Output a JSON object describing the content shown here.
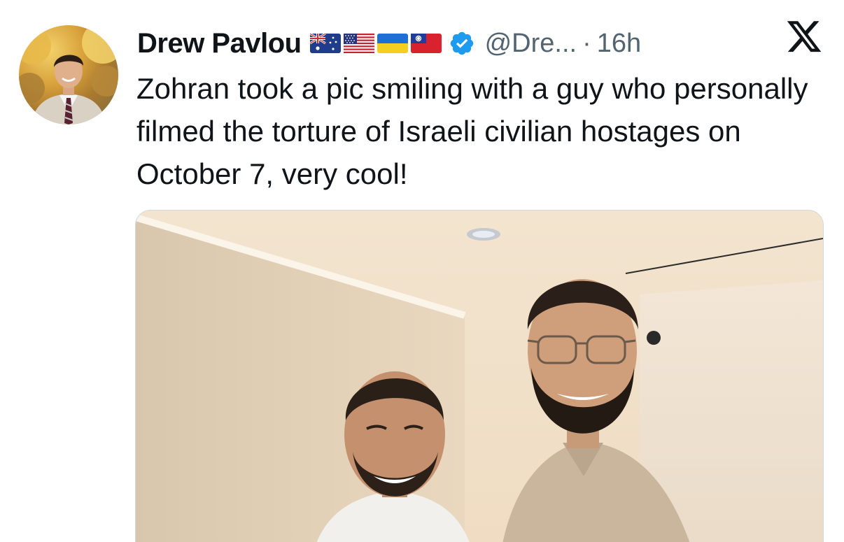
{
  "author": {
    "display_name": "Drew Pavlou",
    "handle": "@Dre...",
    "separator": "·",
    "time": "16h",
    "verified_icon": "verified-badge-icon",
    "flags": [
      {
        "name": "australia-flag-icon"
      },
      {
        "name": "united-states-flag-icon"
      },
      {
        "name": "ukraine-flag-icon"
      },
      {
        "name": "taiwan-flag-icon"
      }
    ]
  },
  "platform_icon": "x-logo-icon",
  "tweet": {
    "text": "Zohran took a pic smiling with a guy who personally filmed the torture of Israeli civilian hostages on October 7, very cool!"
  },
  "media": {
    "type": "photo"
  },
  "colors": {
    "text_primary": "#0f1419",
    "text_secondary": "#536471",
    "verified_blue": "#1d9bf0",
    "media_border": "#cfd9de"
  }
}
